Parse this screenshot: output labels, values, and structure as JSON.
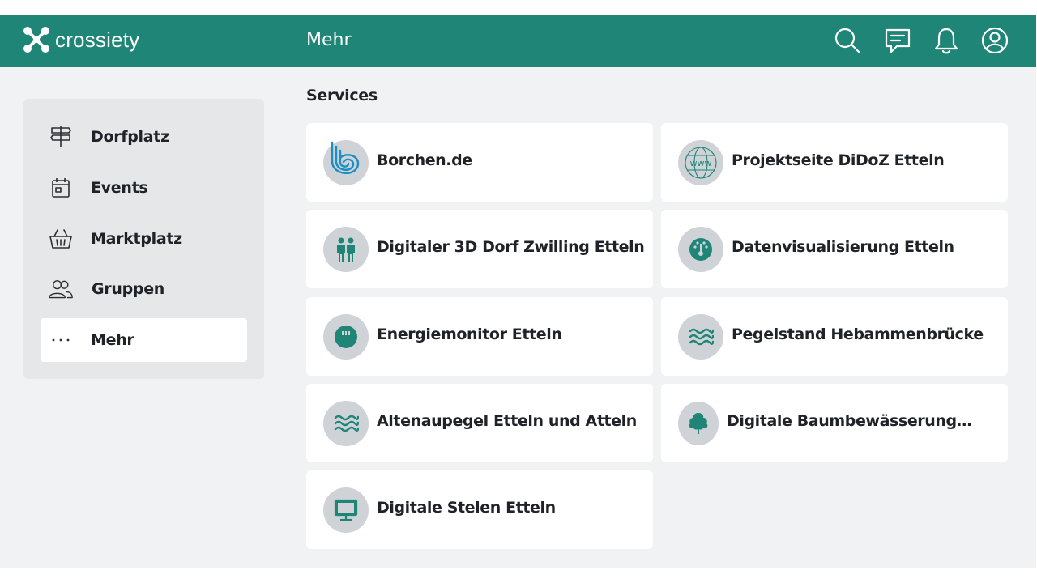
{
  "app": {
    "name": "crossiety"
  },
  "header": {
    "title": "Mehr",
    "icons": [
      "search-icon",
      "chat-icon",
      "bell-icon",
      "user-icon"
    ]
  },
  "sidebar": {
    "items": [
      {
        "label": "Dorfplatz",
        "icon": "signpost-icon"
      },
      {
        "label": "Events",
        "icon": "calendar-icon"
      },
      {
        "label": "Marktplatz",
        "icon": "basket-icon"
      },
      {
        "label": "Gruppen",
        "icon": "users-icon"
      },
      {
        "label": "Mehr",
        "icon": "more-icon",
        "active": true
      }
    ]
  },
  "services": {
    "title": "Services",
    "items": [
      {
        "label": "Borchen.de",
        "icon": "borchen-logo-icon"
      },
      {
        "label": "Projektseite DiDoZ Etteln",
        "icon": "globe-www-icon"
      },
      {
        "label": "Digitaler 3D Dorf Zwilling Etteln",
        "icon": "people-icon"
      },
      {
        "label": "Datenvisualisierung Etteln",
        "icon": "gauge-icon"
      },
      {
        "label": "Energiemonitor Etteln",
        "icon": "meter-icon"
      },
      {
        "label": "Pegelstand Hebammenbrücke",
        "icon": "waves-icon"
      },
      {
        "label": "Altenaupegel Etteln und Atteln",
        "icon": "waves-icon"
      },
      {
        "label": "Digitale Baumbewässerung…",
        "icon": "tree-icon"
      },
      {
        "label": "Digitale Stelen Etteln",
        "icon": "monitor-icon"
      }
    ]
  },
  "colors": {
    "brand": "#1e8577",
    "icon_bg": "#cfd2d6",
    "borchen_blue": "#1a8fc4"
  }
}
